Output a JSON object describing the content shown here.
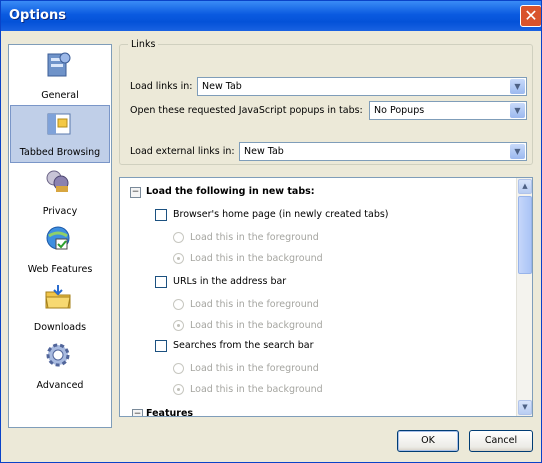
{
  "window": {
    "title": "Options"
  },
  "sidebar": {
    "items": [
      {
        "label": "General",
        "icon": "general-icon"
      },
      {
        "label": "Tabbed Browsing",
        "icon": "tabbed-browsing-icon"
      },
      {
        "label": "Privacy",
        "icon": "privacy-icon"
      },
      {
        "label": "Web Features",
        "icon": "web-features-icon"
      },
      {
        "label": "Downloads",
        "icon": "downloads-icon"
      },
      {
        "label": "Advanced",
        "icon": "advanced-icon"
      }
    ],
    "selected": "Tabbed Browsing"
  },
  "links_group": {
    "legend": "Links",
    "load_links_label": "Load links in:",
    "load_links_value": "New Tab",
    "popups_label": "Open these requested JavaScript popups in tabs:",
    "popups_value": "No Popups",
    "external_label": "Load external links in:",
    "external_value": "New Tab"
  },
  "tree": {
    "section1": "Load the following in new tabs:",
    "homepage": "Browser's home page (in newly created tabs)",
    "urls": "URLs in the address bar",
    "searches": "Searches from the search bar",
    "foreground": "Load this in the foreground",
    "background": "Load this in the background",
    "section2": "Features"
  },
  "buttons": {
    "ok": "OK",
    "cancel": "Cancel"
  },
  "colors": {
    "titlebar": "#0a5ae0",
    "close": "#d9532c",
    "selection": "#c0cfe8"
  }
}
